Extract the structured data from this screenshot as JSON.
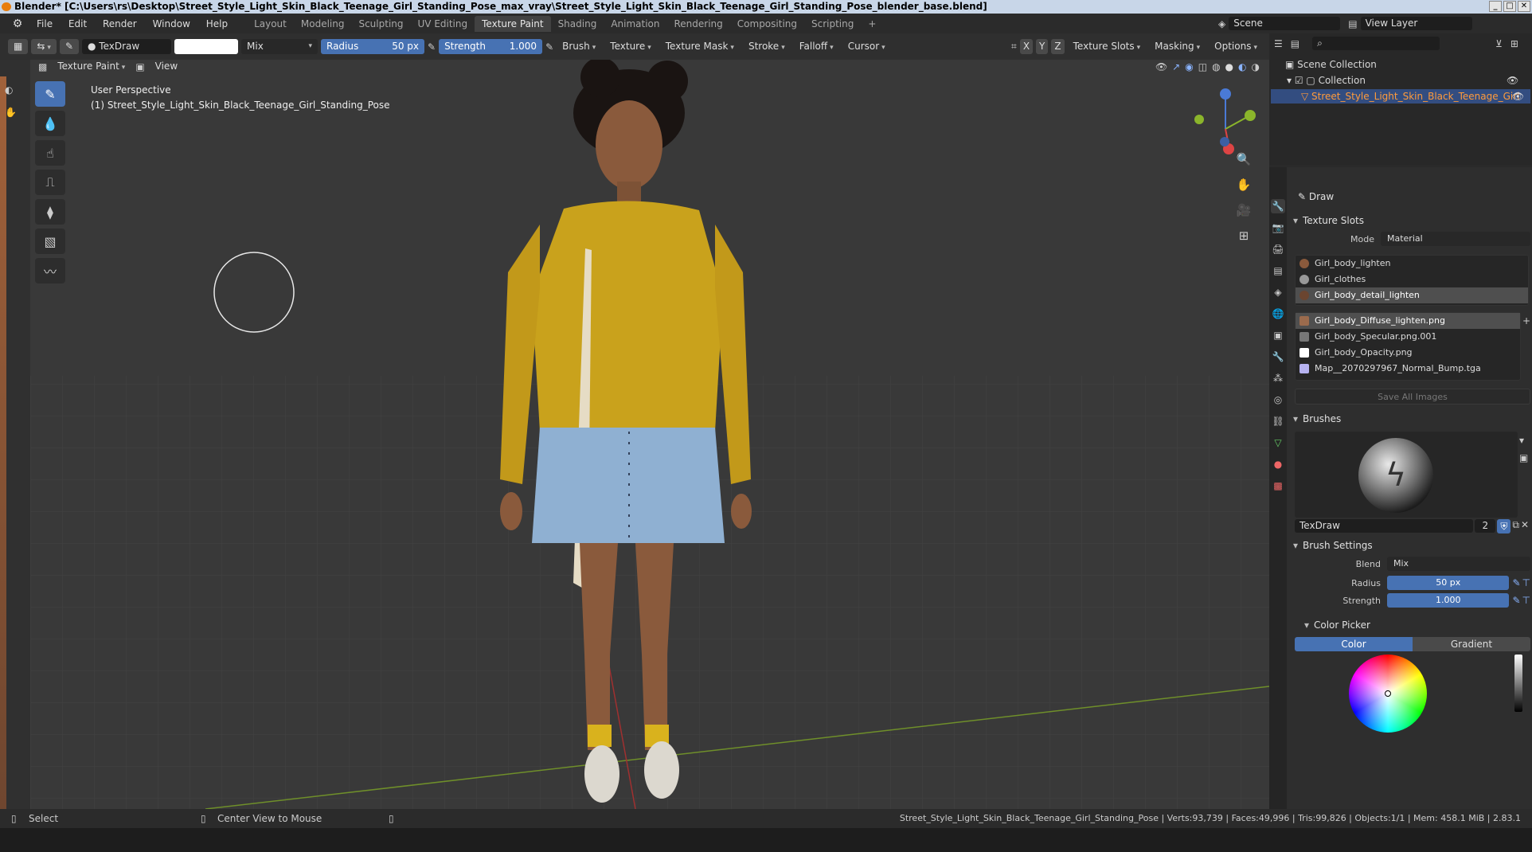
{
  "window": {
    "title": "Blender* [C:\\Users\\rs\\Desktop\\Street_Style_Light_Skin_Black_Teenage_Girl_Standing_Pose_max_vray\\Street_Style_Light_Skin_Black_Teenage_Girl_Standing_Pose_blender_base.blend]"
  },
  "menu": {
    "items": [
      "File",
      "Edit",
      "Render",
      "Window",
      "Help"
    ]
  },
  "workspaces": [
    "Layout",
    "Modeling",
    "Sculpting",
    "UV Editing",
    "Texture Paint",
    "Shading",
    "Animation",
    "Rendering",
    "Compositing",
    "Scripting"
  ],
  "active_workspace": "Texture Paint",
  "scene": {
    "name": "Scene",
    "view_layer": "View Layer"
  },
  "toolbar": {
    "brush_name": "TexDraw",
    "blend": "Mix",
    "radius_label": "Radius",
    "radius_value": "50 px",
    "strength_label": "Strength",
    "strength_value": "1.000",
    "brush": "Brush",
    "texture": "Texture",
    "texture_mask": "Texture Mask",
    "stroke": "Stroke",
    "falloff": "Falloff",
    "cursor": "Cursor",
    "texture_slots": "Texture Slots",
    "masking": "Masking",
    "options": "Options",
    "x": "X",
    "y": "Y",
    "z": "Z"
  },
  "header2": {
    "mode": "Texture Paint",
    "view": "View"
  },
  "viewport": {
    "perspective": "User Perspective",
    "object": "(1) Street_Style_Light_Skin_Black_Teenage_Girl_Standing_Pose"
  },
  "outliner": {
    "scene_collection": "Scene Collection",
    "collection": "Collection",
    "object": "Street_Style_Light_Skin_Black_Teenage_Girl"
  },
  "properties": {
    "tool": "Draw",
    "texture_slots_title": "Texture Slots",
    "mode_label": "Mode",
    "mode_value": "Material",
    "materials": [
      "Girl_body_lighten",
      "Girl_clothes",
      "Girl_body_detail_lighten"
    ],
    "images": [
      {
        "name": "Girl_body_Diffuse_lighten.png",
        "color": "#9b6b4d"
      },
      {
        "name": "Girl_body_Specular.png.001",
        "color": "#777777"
      },
      {
        "name": "Girl_body_Opacity.png",
        "color": "#ffffff"
      },
      {
        "name": "Map__2070297967_Normal_Bump.tga",
        "color": "#b6b2f0"
      }
    ],
    "save_all": "Save All Images",
    "brushes_title": "Brushes",
    "brush_name": "TexDraw",
    "brush_users": "2",
    "brush_settings_title": "Brush Settings",
    "blend_label": "Blend",
    "blend_value": "Mix",
    "radius_label": "Radius",
    "radius_value": "50 px",
    "strength_label": "Strength",
    "strength_value": "1.000",
    "color_picker_title": "Color Picker",
    "color_tab": "Color",
    "gradient_tab": "Gradient"
  },
  "status": {
    "select": "Select",
    "center": "Center View to Mouse",
    "info": "Street_Style_Light_Skin_Black_Teenage_Girl_Standing_Pose | Verts:93,739 | Faces:49,996 | Tris:99,826 | Objects:1/1 | Mem: 458.1 MiB | 2.83.1"
  },
  "colors": {
    "accent": "#4772b3",
    "sweater": "#c9a21c",
    "skirt": "#8fb0d2"
  }
}
